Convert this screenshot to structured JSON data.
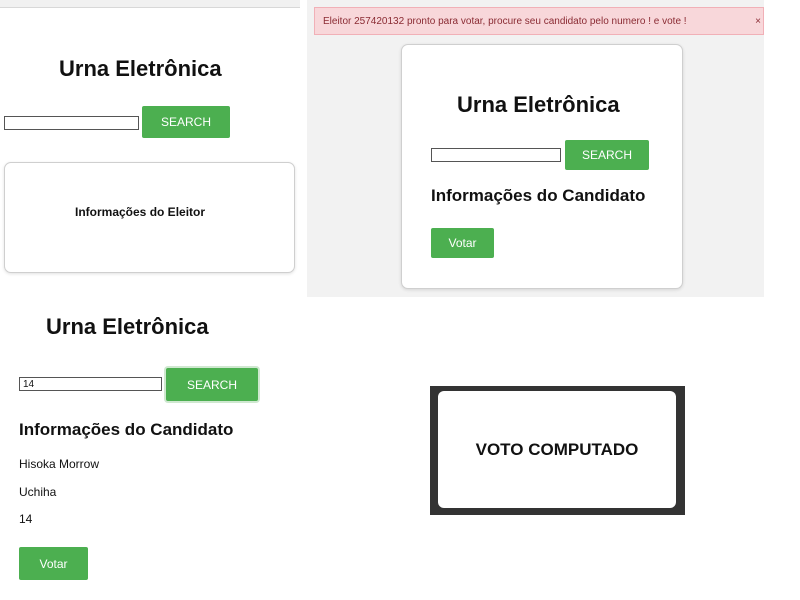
{
  "panel_voter": {
    "title": "Urna Eletrônica",
    "search": {
      "value": "",
      "button_label": "SEARCH"
    },
    "card_label": "Informações do Eleitor"
  },
  "panel_candidate_empty": {
    "alert_text": "Eleitor 257420132 pronto para votar, procure seu candidato pelo numero ! e vote !",
    "alert_close": "×",
    "title": "Urna Eletrônica",
    "search": {
      "value": "",
      "button_label": "SEARCH"
    },
    "heading": "Informações do Candidato",
    "vote_button_label": "Votar"
  },
  "panel_candidate_found": {
    "title": "Urna Eletrônica",
    "search": {
      "value": "14",
      "button_label": "SEARCH"
    },
    "heading": "Informações do Candidato",
    "candidate": {
      "name": "Hisoka Morrow",
      "party": "Uchiha",
      "number": "14"
    },
    "vote_button_label": "Votar"
  },
  "panel_vote_confirmed": {
    "message": "VOTO COMPUTADO"
  },
  "colors": {
    "accent_green": "#4caf50",
    "alert_background": "#f8d7da",
    "alert_text": "#8a2b33",
    "frame_dark": "#333333"
  }
}
